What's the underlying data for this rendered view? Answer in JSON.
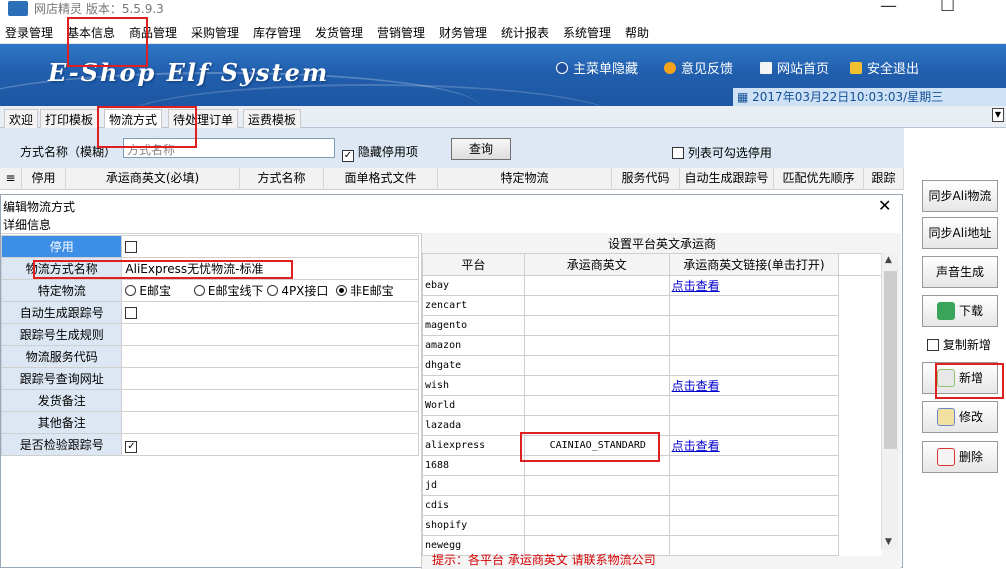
{
  "window": {
    "title": "网店精灵  版本：5.5.9.3",
    "min": "—",
    "max": "☐"
  },
  "menu": [
    "登录管理",
    "基本信息",
    "商品管理",
    "采购管理",
    "库存管理",
    "发货管理",
    "营销管理",
    "财务管理",
    "统计报表",
    "系统管理",
    "帮助"
  ],
  "banner": {
    "logo": "E-Shop Elf System",
    "links": [
      "主菜单隐藏",
      "意见反馈",
      "网站首页",
      "安全退出"
    ],
    "datetime": "2017年03月22日10:03:03/星期三"
  },
  "tabs": [
    "欢迎",
    "打印模板",
    "物流方式",
    "待处理订单",
    "运费模板"
  ],
  "filter": {
    "label": "方式名称（模糊）",
    "input_value": "方式名称",
    "hide_disabled": "隐藏停用项",
    "query": "查询",
    "list_check": "列表可勾选停用"
  },
  "grid_columns": [
    "停用",
    "承运商英文(必填)",
    "方式名称",
    "面单格式文件",
    "特定物流",
    "服务代码",
    "自动生成跟踪号",
    "匹配优先顺序",
    "跟踪"
  ],
  "right_buttons": [
    "同步Ali物流",
    "同步Ali地址",
    "声音生成",
    "下载",
    "复制新增",
    "新增",
    "修改",
    "删除"
  ],
  "dialog": {
    "title": "编辑物流方式",
    "detail": "详细信息",
    "form": [
      {
        "label": "停用",
        "value": ""
      },
      {
        "label": "物流方式名称",
        "value": "AliExpress无忧物流-标准"
      },
      {
        "label": "特定物流",
        "value": ""
      },
      {
        "label": "自动生成跟踪号",
        "value": ""
      },
      {
        "label": "跟踪号生成规则",
        "value": ""
      },
      {
        "label": "物流服务代码",
        "value": ""
      },
      {
        "label": "跟踪号查询网址",
        "value": ""
      },
      {
        "label": "发货备注",
        "value": ""
      },
      {
        "label": "其他备注",
        "value": ""
      },
      {
        "label": "是否检验跟踪号",
        "value": ""
      }
    ],
    "radio_options": [
      "E邮宝",
      "E邮宝线下",
      "4PX接口",
      "非E邮宝"
    ],
    "platform_panel": {
      "title": "设置平台英文承运商",
      "headers": [
        "平台",
        "承运商英文",
        "承运商英文链接(单击打开)"
      ],
      "rows": [
        {
          "platform": "ebay",
          "carrier": "",
          "link": "点击查看"
        },
        {
          "platform": "zencart",
          "carrier": "",
          "link": ""
        },
        {
          "platform": "magento",
          "carrier": "",
          "link": ""
        },
        {
          "platform": "amazon",
          "carrier": "",
          "link": ""
        },
        {
          "platform": "dhgate",
          "carrier": "",
          "link": ""
        },
        {
          "platform": "wish",
          "carrier": "",
          "link": "点击查看"
        },
        {
          "platform": "World",
          "carrier": "",
          "link": ""
        },
        {
          "platform": "lazada",
          "carrier": "",
          "link": ""
        },
        {
          "platform": "aliexpress",
          "carrier": "CAINIAO_STANDARD",
          "link": "点击查看"
        },
        {
          "platform": "1688",
          "carrier": "",
          "link": ""
        },
        {
          "platform": "jd",
          "carrier": "",
          "link": ""
        },
        {
          "platform": "cdis",
          "carrier": "",
          "link": ""
        },
        {
          "platform": "shopify",
          "carrier": "",
          "link": ""
        },
        {
          "platform": "newegg",
          "carrier": "",
          "link": ""
        }
      ],
      "hint": "提示：各平台 承运商英文 请联系物流公司"
    }
  }
}
